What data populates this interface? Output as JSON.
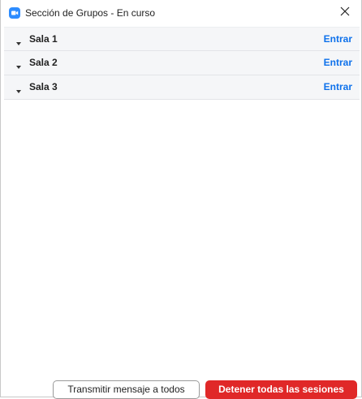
{
  "window": {
    "title": "Sección de Grupos - En curso",
    "app_icon": "zoom-camera-icon",
    "close_icon": "close-icon"
  },
  "rooms": [
    {
      "name": "Sala 1",
      "action": "Entrar"
    },
    {
      "name": "Sala 2",
      "action": "Entrar"
    },
    {
      "name": "Sala 3",
      "action": "Entrar"
    }
  ],
  "footer": {
    "broadcast_label": "Transmitir mensaje a todos",
    "stop_label": "Detener todas las sesiones"
  },
  "colors": {
    "accent": "#0e71eb",
    "danger": "#e02828",
    "row_bg": "#f5f6f8"
  }
}
